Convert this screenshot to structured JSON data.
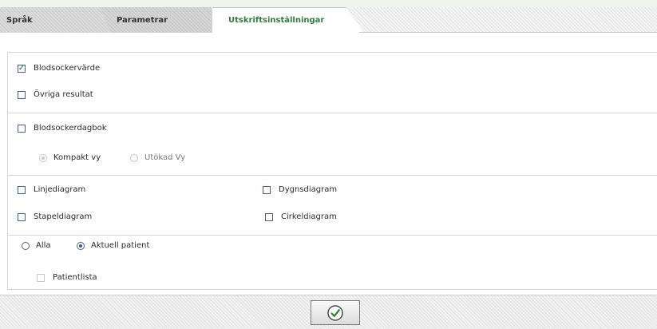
{
  "tabs": [
    {
      "label": "Språk"
    },
    {
      "label": "Parametrar"
    },
    {
      "label": "Utskriftsinställningar",
      "active": true
    }
  ],
  "options": {
    "blodsockervarde": {
      "label": "Blodsockervärde",
      "checked": true
    },
    "ovriga_resultat": {
      "label": "Övriga resultat",
      "checked": false
    },
    "blodsockerdagbok": {
      "label": "Blodsockerdagbok",
      "checked": false
    },
    "view_mode": {
      "kompakt": {
        "label": "Kompakt vy",
        "checked": true,
        "enabled": false
      },
      "utokad": {
        "label": "Utökad Vy",
        "checked": false,
        "enabled": false
      }
    },
    "linjediagram": {
      "label": "Linjediagram",
      "checked": false
    },
    "dygnsdiagram": {
      "label": "Dygnsdiagram",
      "checked": false
    },
    "stapeldiagram": {
      "label": "Stapeldiagram",
      "checked": false
    },
    "cirkeldiagram": {
      "label": "Cirkeldiagram",
      "checked": false
    },
    "patient_scope": {
      "alla": {
        "label": "Alla",
        "checked": false
      },
      "aktuell": {
        "label": "Aktuell patient",
        "checked": true
      }
    },
    "patientlista": {
      "label": "Patientlista",
      "checked": false,
      "enabled": false
    }
  },
  "footer": {
    "ok_icon": "checkmark-circle-icon"
  },
  "colors": {
    "active_tab_text": "#2e7d3a",
    "checkbox_border": "#43619a",
    "check_mark": "#1b7a1b"
  }
}
